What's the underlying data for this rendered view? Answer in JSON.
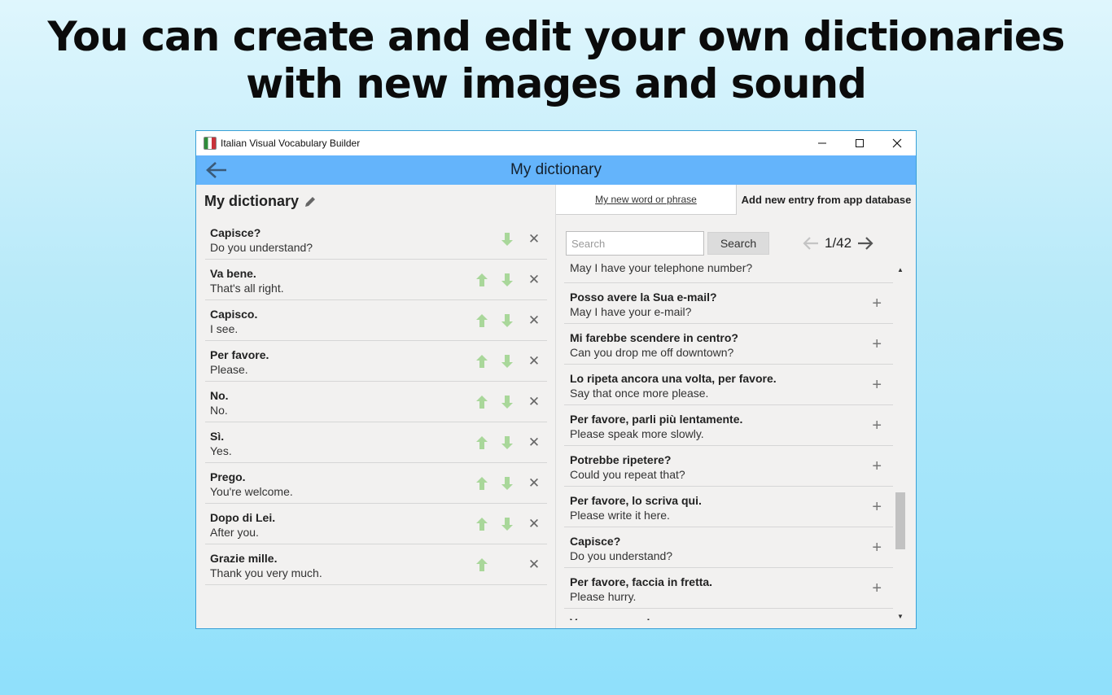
{
  "headline": {
    "line1": "You can create and edit your own dictionaries",
    "line2": "with new images and sound"
  },
  "window": {
    "title": "Italian Visual Vocabulary Builder",
    "minimize_glyph": "—",
    "close_glyph": "✕"
  },
  "appbar": {
    "title": "My dictionary"
  },
  "left": {
    "title": "My dictionary",
    "entries": [
      {
        "it": "Capisce?",
        "en": "Do you understand?",
        "up": false,
        "down": true
      },
      {
        "it": "Va bene.",
        "en": "That's all right.",
        "up": true,
        "down": true
      },
      {
        "it": "Capisco.",
        "en": "I see.",
        "up": true,
        "down": true
      },
      {
        "it": "Per favore.",
        "en": "Please.",
        "up": true,
        "down": true
      },
      {
        "it": "No.",
        "en": "No.",
        "up": true,
        "down": true
      },
      {
        "it": "Sì.",
        "en": "Yes.",
        "up": true,
        "down": true
      },
      {
        "it": "Prego.",
        "en": "You're welcome.",
        "up": true,
        "down": true
      },
      {
        "it": "Dopo di Lei.",
        "en": "After you.",
        "up": true,
        "down": true
      },
      {
        "it": "Grazie mille.",
        "en": "Thank you very much.",
        "up": true,
        "down": false
      }
    ],
    "delete_glyph": "✕"
  },
  "right": {
    "tab_new": "My new word or phrase",
    "tab_database": "Add new entry from app database",
    "search": {
      "placeholder": "Search",
      "button": "Search"
    },
    "pager": "1/42",
    "first_partial": "May I have your telephone number?",
    "results": [
      {
        "it": "Posso avere la Sua e-mail?",
        "en": "May I have your e-mail?"
      },
      {
        "it": "Mi farebbe scendere in centro?",
        "en": "Can you drop me off downtown?"
      },
      {
        "it": "Lo ripeta ancora una volta, per favore.",
        "en": "Say that once more please."
      },
      {
        "it": "Per favore, parli più lentamente.",
        "en": "Please speak more slowly."
      },
      {
        "it": "Potrebbe ripetere?",
        "en": "Could you repeat that?"
      },
      {
        "it": "Per favore, lo scriva qui.",
        "en": "Please write it here."
      },
      {
        "it": "Capisce?",
        "en": "Do you understand?"
      },
      {
        "it": "Per favore, faccia in fretta.",
        "en": "Please hurry."
      }
    ],
    "add_glyph": "+",
    "partial_last": "Venga con me!",
    "colors": {
      "appbar": "#64b4fb",
      "arrow_green": "#a9d79a"
    }
  }
}
